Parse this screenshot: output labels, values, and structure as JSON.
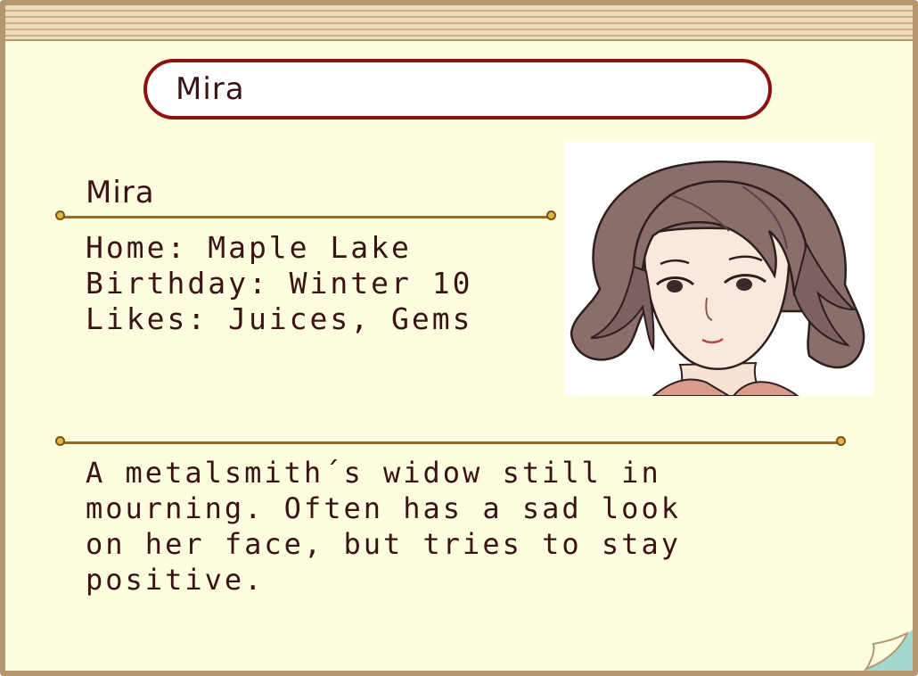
{
  "header": {
    "name_field_value": "Mira"
  },
  "profile": {
    "name": "Mira",
    "home": "Home: Maple Lake",
    "birthday": "Birthday: Winter 10",
    "likes": "Likes: Juices, Gems",
    "portrait_icon": "character-portrait"
  },
  "description": {
    "line1": "A metalsmith´s widow still in",
    "line2": "mourning. Often has a sad look",
    "line3": "on her face, but tries to stay",
    "line4": "positive."
  },
  "colors": {
    "paper": "#fffde0",
    "frame": "#b39770",
    "name_border": "#8e1010",
    "text": "#3a1414",
    "divider": "#946a1e",
    "hair": "#8a6e6c"
  }
}
